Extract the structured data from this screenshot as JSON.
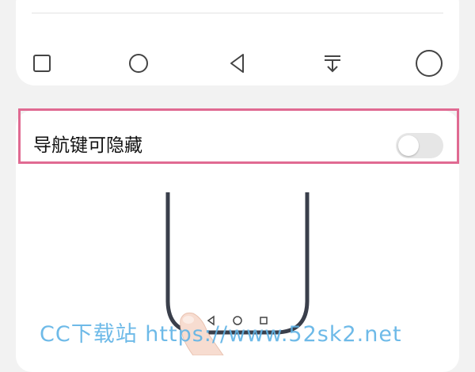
{
  "nav_style_options": [
    {
      "icon": "square-icon"
    },
    {
      "icon": "circle-icon"
    },
    {
      "icon": "triangle-back-icon"
    },
    {
      "icon": "pull-down-icon"
    },
    {
      "icon": "large-circle-icon"
    }
  ],
  "hide_nav_setting": {
    "label": "导航键可隐藏",
    "enabled": false
  },
  "illustration": {
    "phone_nav_icons": [
      "back-triangle-icon",
      "home-circle-icon",
      "recent-square-icon"
    ]
  },
  "watermark": {
    "text": "CC下载站 https://www.52sk2.net"
  },
  "colors": {
    "highlight_border": "#e06a92",
    "toggle_off": "#e6e6e6",
    "watermark": "#5fb3e6"
  }
}
